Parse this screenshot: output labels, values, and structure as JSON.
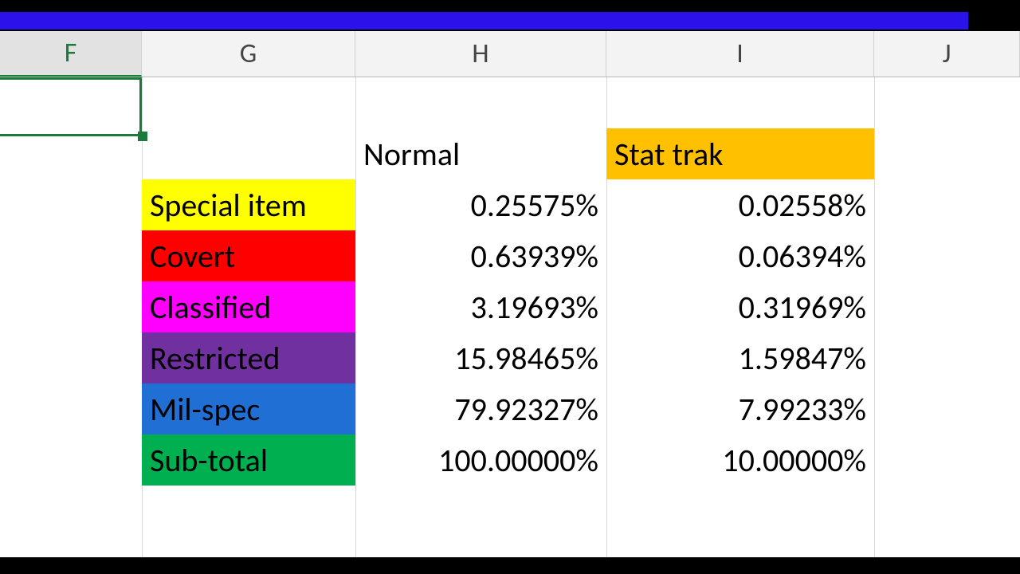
{
  "columns": {
    "F": "F",
    "G": "G",
    "H": "H",
    "I": "I",
    "J": "J"
  },
  "headers": {
    "normal": "Normal",
    "stattrak": "Stat trak"
  },
  "rows": [
    {
      "label": "Special item",
      "normal": "0.25575%",
      "stattrak": "0.02558%",
      "bg": "#ffff00"
    },
    {
      "label": "Covert",
      "normal": "0.63939%",
      "stattrak": "0.06394%",
      "bg": "#ff0000"
    },
    {
      "label": "Classified",
      "normal": "3.19693%",
      "stattrak": "0.31969%",
      "bg": "#ff00ff"
    },
    {
      "label": "Restricted",
      "normal": "15.98465%",
      "stattrak": "1.59847%",
      "bg": "#7030a0"
    },
    {
      "label": "Mil-spec",
      "normal": "79.92327%",
      "stattrak": "7.99233%",
      "bg": "#1f6fd4"
    },
    {
      "label": "Sub-total",
      "normal": "100.00000%",
      "stattrak": "10.00000%",
      "bg": "#00b050"
    }
  ]
}
